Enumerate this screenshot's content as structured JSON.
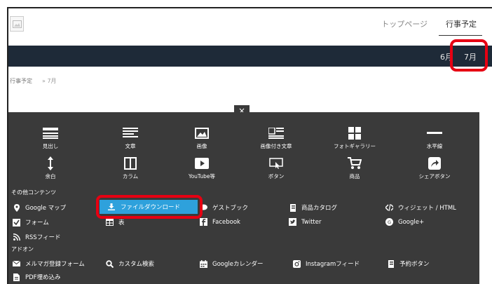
{
  "header": {
    "nav": [
      "トップページ",
      "行事予定"
    ],
    "months": [
      "6月",
      "7月"
    ]
  },
  "breadcrumb": {
    "root": "行事予定",
    "current": "» 7月"
  },
  "close_label": "×",
  "blocks_row1": [
    "見出し",
    "文章",
    "画像",
    "画像付き文章",
    "フォトギャラリー",
    "水平線"
  ],
  "blocks_row2": [
    "余白",
    "カラム",
    "YouTube等",
    "ボタン",
    "商品",
    "シェアボタン"
  ],
  "other_contents": {
    "label": "その他コンテンツ",
    "items": [
      "Google マップ",
      "ファイルダウンロード",
      "ゲストブック",
      "商品カタログ",
      "ウィジェット / HTML",
      "フォーム",
      "表",
      "Facebook",
      "Twitter",
      "Google+",
      "RSSフィード"
    ]
  },
  "addons": {
    "label": "アドオン",
    "items": [
      "メルマガ登録フォーム",
      "カスタム検索",
      "Googleカレンダー",
      "Instagramフィード",
      "予約ボタン",
      "PDF埋め込み"
    ]
  },
  "colors": {
    "navbar": "#1e2a38",
    "panel": "#3a3a3a",
    "highlight": "#2ea1dc",
    "ring": "#e60012"
  }
}
